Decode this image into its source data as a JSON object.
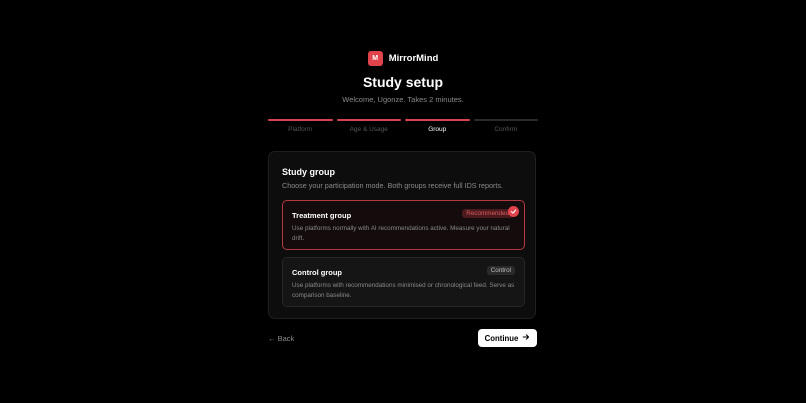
{
  "brand": {
    "logo_letter": "M",
    "name": "MirrorMind",
    "color": "#e0434b"
  },
  "header": {
    "title": "Study setup",
    "subtitle": "Welcome, Ugonze. Takes 2 minutes."
  },
  "steps": [
    {
      "label": "Platform",
      "state": "done"
    },
    {
      "label": "Age & Usage",
      "state": "done"
    },
    {
      "label": "Group",
      "state": "active"
    },
    {
      "label": "Confirm",
      "state": "pending"
    }
  ],
  "study_group": {
    "title": "Study group",
    "description": "Choose your participation mode. Both groups receive full IDS reports.",
    "options": [
      {
        "title": "Treatment group",
        "badge": "Recommended",
        "description": "Use platforms normally with AI recommendations active. Measure your natural drift.",
        "selected": true
      },
      {
        "title": "Control group",
        "badge": "Control",
        "description": "Use platforms with recommendations minimised or chronological feed. Serve as comparison baseline.",
        "selected": false
      }
    ]
  },
  "actions": {
    "back_label": "← Back",
    "continue_label": "Continue",
    "continue_icon": "arrow-right-icon"
  }
}
